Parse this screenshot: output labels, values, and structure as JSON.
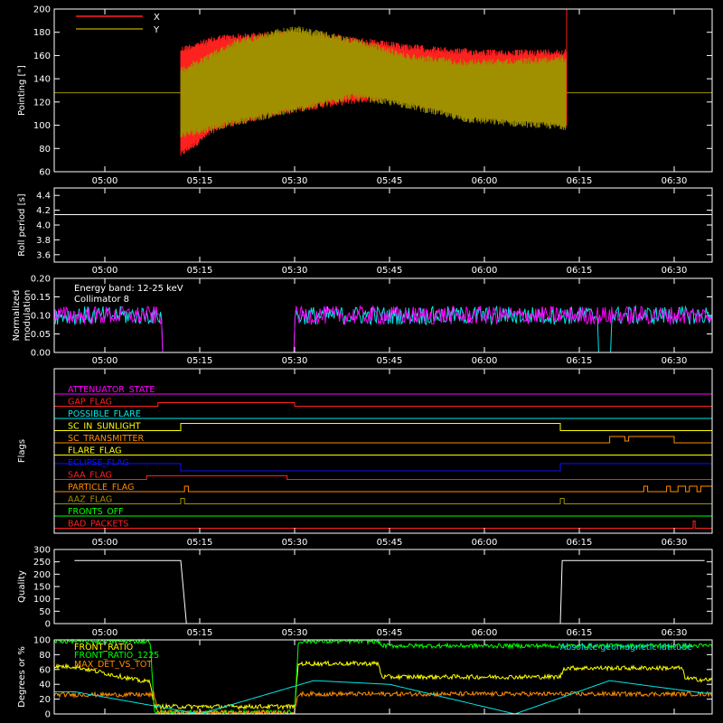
{
  "colors": {
    "background": "#000000",
    "foreground": "#ffffff",
    "red": "#ff2020",
    "olive": "#a09000",
    "cyan": "#00e8e8",
    "magenta": "#ff00ff",
    "green": "#00ff00",
    "yellow": "#ffff00",
    "orange": "#ff8c00",
    "blue": "#1010ff"
  },
  "time_axis": {
    "range": [
      "04:55",
      "06:35"
    ],
    "ticks": [
      "05:00",
      "05:15",
      "05:30",
      "05:45",
      "06:00",
      "06:15",
      "06:30"
    ]
  },
  "chart_data": [
    {
      "type": "line",
      "ylabel": "Pointing [\"]",
      "ylim": [
        60,
        200
      ],
      "yticks": [
        "60",
        "80",
        "100",
        "120",
        "140",
        "160",
        "180",
        "200"
      ],
      "legend": [
        {
          "label": "X",
          "color": "#ff2020"
        },
        {
          "label": "Y",
          "color": "#a09000"
        }
      ],
      "data_window": [
        "05:12",
        "06:13"
      ],
      "baseline": 128,
      "series": [
        {
          "name": "X",
          "color": "#ff2020",
          "upper": [
            [
              5.2,
              168
            ],
            [
              5.3,
              178
            ],
            [
              5.45,
              181
            ],
            [
              5.6,
              179
            ],
            [
              5.75,
              172
            ],
            [
              5.9,
              167
            ],
            [
              6.05,
              165
            ],
            [
              6.2,
              166
            ]
          ],
          "lower": [
            [
              5.2,
              72
            ],
            [
              5.3,
              96
            ],
            [
              5.45,
              108
            ],
            [
              5.6,
              116
            ],
            [
              5.75,
              122
            ],
            [
              5.9,
              110
            ],
            [
              6.05,
              110
            ],
            [
              6.2,
              108
            ]
          ]
        },
        {
          "name": "Y",
          "color": "#a09000",
          "upper": [
            [
              5.2,
              150
            ],
            [
              5.35,
              175
            ],
            [
              5.5,
              186
            ],
            [
              5.65,
              176
            ],
            [
              5.8,
              162
            ],
            [
              5.95,
              157
            ],
            [
              6.1,
              158
            ],
            [
              6.2,
              160
            ]
          ],
          "lower": [
            [
              5.2,
              88
            ],
            [
              5.35,
              100
            ],
            [
              5.5,
              110
            ],
            [
              5.65,
              122
            ],
            [
              5.8,
              114
            ],
            [
              5.95,
              102
            ],
            [
              6.1,
              98
            ],
            [
              6.2,
              96
            ]
          ]
        }
      ]
    },
    {
      "type": "line",
      "ylabel": "Roll period [s]",
      "ylim": [
        3.5,
        4.5
      ],
      "yticks": [
        "3.6",
        "3.8",
        "4.0",
        "4.2",
        "4.4"
      ],
      "series": [
        {
          "values": [
            [
              4.92,
              4.14
            ],
            [
              6.58,
              4.14
            ]
          ]
        }
      ]
    },
    {
      "type": "line",
      "ylabel": "Normalized modulation",
      "ylim": [
        0,
        0.2
      ],
      "yticks": [
        "0.00",
        "0.05",
        "0.10",
        "0.15",
        "0.20"
      ],
      "annotations": [
        "Energy band: 12-25 keV",
        "Collimator 8"
      ],
      "dropout_magenta": [
        [
          "05:09",
          "05:30"
        ]
      ],
      "dropout_cyan": [
        [
          "05:09",
          "05:30"
        ],
        [
          "06:18",
          "06:20"
        ]
      ],
      "mean": 0.1
    },
    {
      "type": "table",
      "ylabel": "Flags",
      "flags": [
        {
          "name": "ATTENUATOR_STATE",
          "color": "#ff00ff"
        },
        {
          "name": "GAP_FLAG",
          "color": "#ff2020"
        },
        {
          "name": "POSSIBLE_FLARE",
          "color": "#00e8e8"
        },
        {
          "name": "SC_IN_SUNLIGHT",
          "color": "#ffff00"
        },
        {
          "name": "SC_TRANSMITTER",
          "color": "#ff8c00"
        },
        {
          "name": "FLARE_FLAG",
          "color": "#ffff00"
        },
        {
          "name": "ECLIPSE_FLAG",
          "color": "#1010ff"
        },
        {
          "name": "SAA_FLAG",
          "color": "#ff2020"
        },
        {
          "name": "PARTICLE_FLAG",
          "color": "#ff8c00"
        },
        {
          "name": "AAZ_FLAG",
          "color": "#a09000"
        },
        {
          "name": "FRONTS_OFF",
          "color": "#00ff00"
        },
        {
          "name": "BAD_PACKETS",
          "color": "#ff2020"
        }
      ]
    },
    {
      "type": "line",
      "ylabel": "Quality",
      "ylim": [
        0,
        300
      ],
      "yticks": [
        "0",
        "50",
        "100",
        "150",
        "200",
        "250",
        "300"
      ],
      "series": [
        {
          "values": [
            [
              4.92,
              255
            ],
            [
              5.2,
              255
            ],
            [
              5.215,
              0
            ],
            [
              6.2,
              0
            ],
            [
              6.205,
              255
            ],
            [
              6.58,
              255
            ]
          ]
        }
      ]
    },
    {
      "type": "line",
      "ylabel": "Degrees or %",
      "ylim": [
        0,
        100
      ],
      "yticks": [
        "0",
        "20",
        "40",
        "60",
        "80",
        "100"
      ],
      "legend": [
        {
          "label": "FRONT_RATIO",
          "color": "#ffff00"
        },
        {
          "label": "FRONT_RATIO_1225",
          "color": "#00ff00"
        },
        {
          "label": "MAX_DET_VS_TOT",
          "color": "#ff8c00"
        },
        {
          "label": "Absolute geomagnetic latitude",
          "color": "#00e8e8"
        }
      ],
      "series": [
        {
          "name": "FRONT_RATIO",
          "color": "#ffff00",
          "values": [
            [
              4.92,
              64
            ],
            [
              5.1,
              44
            ],
            [
              5.12,
              44
            ],
            [
              5.13,
              10
            ],
            [
              5.5,
              10
            ],
            [
              5.51,
              68
            ],
            [
              5.72,
              68
            ],
            [
              5.73,
              50
            ],
            [
              6.2,
              50
            ],
            [
              6.21,
              62
            ],
            [
              6.52,
              62
            ],
            [
              6.53,
              48
            ],
            [
              6.58,
              46
            ]
          ]
        },
        {
          "name": "FRONT_RATIO_1225",
          "color": "#00ff00",
          "values": [
            [
              4.92,
              98
            ],
            [
              5.1,
              98
            ],
            [
              5.12,
              98
            ],
            [
              5.13,
              2
            ],
            [
              5.5,
              2
            ],
            [
              5.51,
              98
            ],
            [
              5.72,
              98
            ],
            [
              5.73,
              92
            ],
            [
              6.58,
              92
            ]
          ]
        },
        {
          "name": "MAX_DET_VS_TOT",
          "color": "#ff8c00",
          "values": [
            [
              4.92,
              26
            ],
            [
              5.13,
              26
            ],
            [
              5.14,
              2
            ],
            [
              5.5,
              2
            ],
            [
              5.51,
              27
            ],
            [
              6.58,
              27
            ]
          ]
        },
        {
          "name": "Absolute geomagnetic latitude",
          "color": "#00e8e8",
          "values": [
            [
              4.92,
              30
            ],
            [
              5.25,
              0
            ],
            [
              5.55,
              45
            ],
            [
              5.75,
              40
            ],
            [
              6.08,
              0
            ],
            [
              6.33,
              45
            ],
            [
              6.58,
              28
            ]
          ]
        }
      ]
    }
  ]
}
